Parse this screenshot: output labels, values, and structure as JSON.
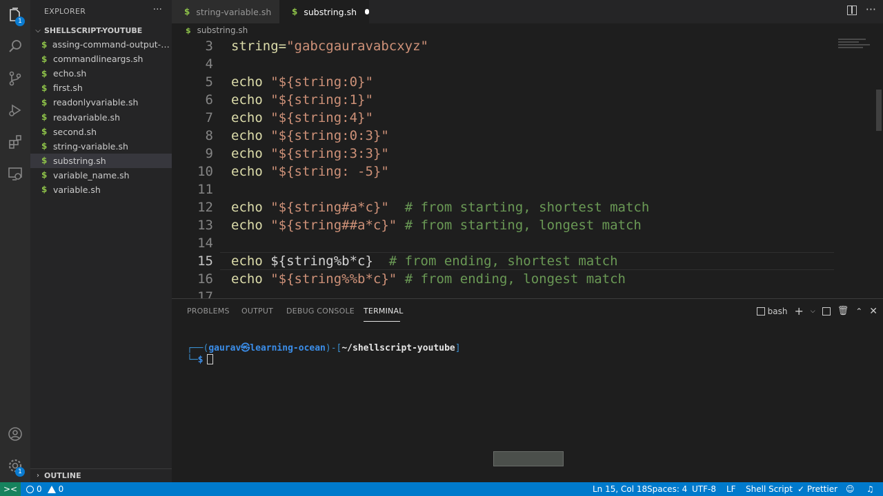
{
  "sidebar": {
    "title": "EXPLORER",
    "more": "···",
    "folder": "SHELLSCRIPT-YOUTUBE",
    "files": [
      {
        "name": "assing-command-output-to-..."
      },
      {
        "name": "commandlineargs.sh"
      },
      {
        "name": "echo.sh"
      },
      {
        "name": "first.sh"
      },
      {
        "name": "readonlyvariable.sh"
      },
      {
        "name": "readvariable.sh"
      },
      {
        "name": "second.sh"
      },
      {
        "name": "string-variable.sh"
      },
      {
        "name": "substring.sh"
      },
      {
        "name": "variable_name.sh"
      },
      {
        "name": "variable.sh"
      }
    ],
    "active_file": "substring.sh",
    "outline": "OUTLINE"
  },
  "activity": {
    "explorer_badge": "1",
    "settings_badge": "1"
  },
  "tabs": [
    {
      "label": "string-variable.sh"
    },
    {
      "label": "substring.sh"
    }
  ],
  "breadcrumb": "substring.sh",
  "file_icon_glyph": "$",
  "code": {
    "current_line": "15",
    "lines": [
      {
        "n": "3",
        "kw": "string=",
        "str": "\"gabcgauravabcxyz\"",
        "rest": "",
        "cmt": ""
      },
      {
        "n": "4",
        "kw": "",
        "str": "",
        "rest": "",
        "cmt": ""
      },
      {
        "n": "5",
        "kw": "echo ",
        "str": "\"${string:0}\"",
        "rest": "",
        "cmt": ""
      },
      {
        "n": "6",
        "kw": "echo ",
        "str": "\"${string:1}\"",
        "rest": "",
        "cmt": ""
      },
      {
        "n": "7",
        "kw": "echo ",
        "str": "\"${string:4}\"",
        "rest": "",
        "cmt": ""
      },
      {
        "n": "8",
        "kw": "echo ",
        "str": "\"${string:0:3}\"",
        "rest": "",
        "cmt": ""
      },
      {
        "n": "9",
        "kw": "echo ",
        "str": "\"${string:3:3}\"",
        "rest": "",
        "cmt": ""
      },
      {
        "n": "10",
        "kw": "echo ",
        "str": "\"${string: -5}\"",
        "rest": "",
        "cmt": ""
      },
      {
        "n": "11",
        "kw": "",
        "str": "",
        "rest": "",
        "cmt": ""
      },
      {
        "n": "12",
        "kw": "echo ",
        "str": "\"${string#a*c}\"",
        "rest": "  ",
        "cmt": "# from starting, shortest match"
      },
      {
        "n": "13",
        "kw": "echo ",
        "str": "\"${string##a*c}\"",
        "rest": " ",
        "cmt": "# from starting, longest match"
      },
      {
        "n": "14",
        "kw": "",
        "str": "",
        "rest": "",
        "cmt": ""
      },
      {
        "n": "15",
        "kw": "echo ",
        "str": "",
        "rest": "${string%b*c}  ",
        "cmt": "# from ending, shortest match"
      },
      {
        "n": "16",
        "kw": "echo ",
        "str": "\"${string%%b*c}\"",
        "rest": " ",
        "cmt": "# from ending, longest match"
      },
      {
        "n": "17",
        "kw": "",
        "str": "",
        "rest": "",
        "cmt": ""
      }
    ]
  },
  "panel": {
    "tabs": [
      "PROBLEMS",
      "OUTPUT",
      "DEBUG CONSOLE",
      "TERMINAL"
    ],
    "active_tab": "TERMINAL",
    "shell": "bash",
    "prompt": {
      "corner": "┌──",
      "open": "(",
      "user": "gaurav",
      "at": "㉿",
      "host": "learning-ocean",
      "close": ")",
      "sep": "-[",
      "path": "~/shellscript-youtube",
      "end": "]",
      "corner2": "└─",
      "dollar": "$"
    }
  },
  "status": {
    "remote": "><",
    "errors": "0",
    "warnings": "0",
    "position": "Ln 15, Col 18",
    "spaces": "Spaces: 4",
    "encoding": "UTF-8",
    "eol": "LF",
    "language": "Shell Script",
    "formatter": "Prettier"
  }
}
